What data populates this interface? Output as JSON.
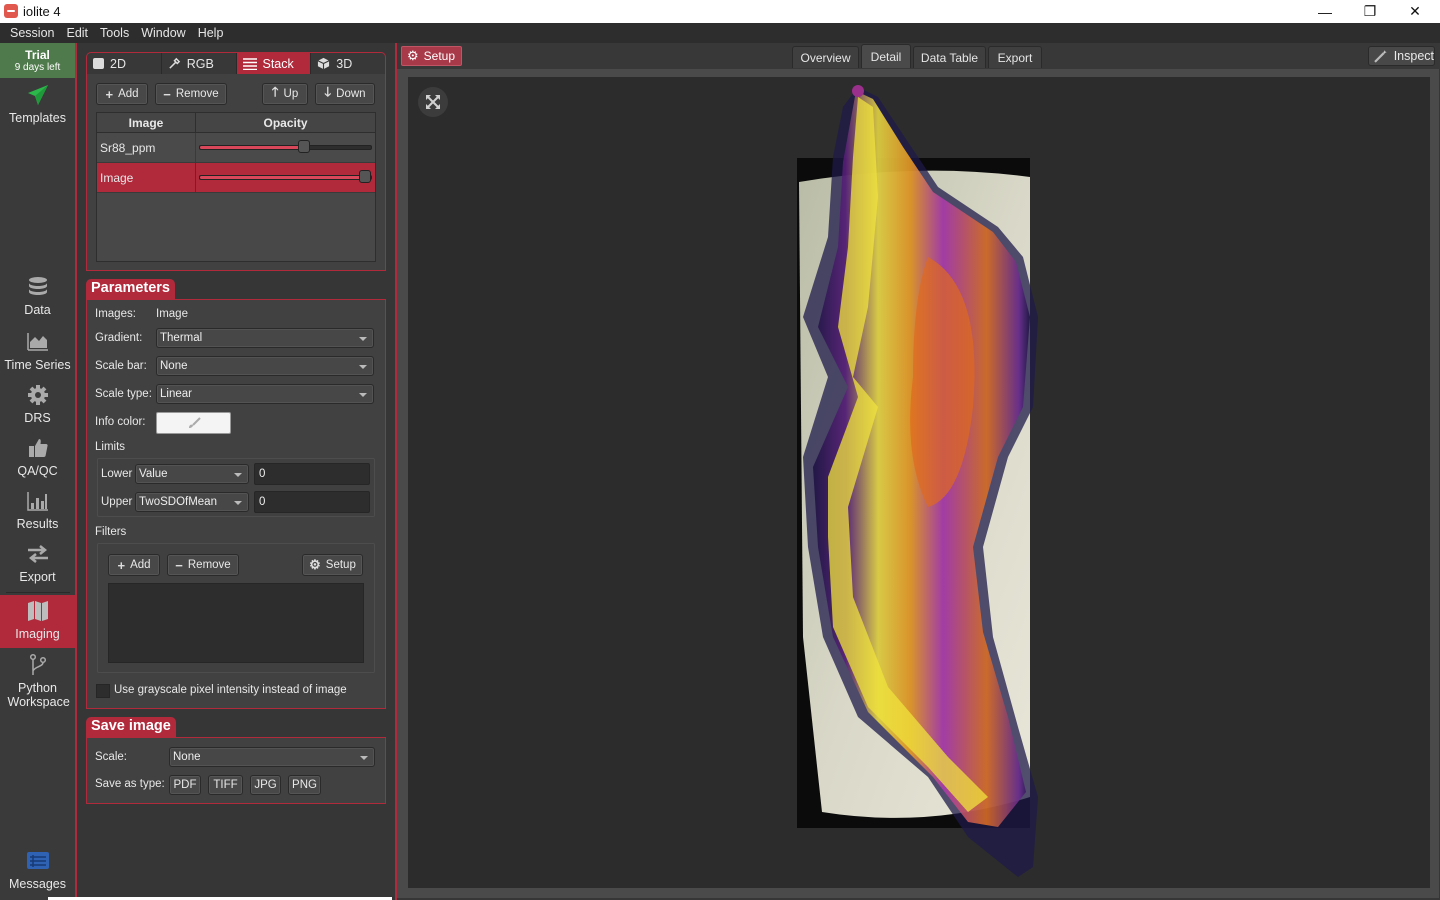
{
  "window": {
    "title": "iolite 4",
    "controls": {
      "minimize": "—",
      "maximize": "❐",
      "close": "✕"
    }
  },
  "menu": [
    "Session",
    "Edit",
    "Tools",
    "Window",
    "Help"
  ],
  "trial": {
    "title": "Trial",
    "subtitle": "9 days left"
  },
  "nav": {
    "templates": "Templates",
    "items": [
      {
        "label": "Data",
        "icon": "database-icon"
      },
      {
        "label": "Time Series",
        "icon": "area-chart-icon"
      },
      {
        "label": "DRS",
        "icon": "gear-icon"
      },
      {
        "label": "QA/QC",
        "icon": "thumbs-up-icon"
      },
      {
        "label": "Results",
        "icon": "bar-chart-icon"
      },
      {
        "label": "Export",
        "icon": "swap-arrows-icon"
      },
      {
        "label": "Imaging",
        "icon": "map-icon",
        "active": true
      },
      {
        "label": "Python Workspace",
        "icon": "git-branch-icon"
      }
    ],
    "messages": "Messages"
  },
  "viewTabs": [
    {
      "label": "2D",
      "icon": "square-icon"
    },
    {
      "label": "RGB",
      "icon": "eyedropper-icon"
    },
    {
      "label": "Stack",
      "icon": "stack-lines-icon",
      "active": true
    },
    {
      "label": "3D",
      "icon": "cube-icon"
    }
  ],
  "layerToolbar": {
    "add": "Add",
    "remove": "Remove",
    "up": "Up",
    "down": "Down"
  },
  "layerTable": {
    "columns": [
      "Image",
      "Opacity"
    ],
    "rows": [
      {
        "name": "Sr88_ppm",
        "opacity": 0.63,
        "selected": false
      },
      {
        "name": "Image",
        "opacity": 1.0,
        "selected": true
      }
    ]
  },
  "parameters": {
    "title": "Parameters",
    "images_label": "Images:",
    "images_value": "Image",
    "gradient_label": "Gradient:",
    "gradient_value": "Thermal",
    "scalebar_label": "Scale bar:",
    "scalebar_value": "None",
    "scaletype_label": "Scale type:",
    "scaletype_value": "Linear",
    "infocolor_label": "Info color:",
    "infocolor_value": "#f4f4f4",
    "limits_label": "Limits",
    "lower_label": "Lower",
    "lower_mode": "Value",
    "lower_value": "0",
    "upper_label": "Upper",
    "upper_mode": "TwoSDOfMean",
    "upper_value": "0",
    "filters_label": "Filters",
    "filters_add": "Add",
    "filters_remove": "Remove",
    "filters_setup": "Setup",
    "grayscale_label": "Use grayscale pixel intensity instead of image",
    "grayscale_checked": false
  },
  "saveImage": {
    "title": "Save image",
    "scale_label": "Scale:",
    "scale_value": "None",
    "saveas_label": "Save as type:",
    "types": [
      "PDF",
      "TIFF",
      "JPG",
      "PNG"
    ]
  },
  "main": {
    "setup": "Setup",
    "tabs": [
      {
        "label": "Overview"
      },
      {
        "label": "Detail",
        "active": true
      },
      {
        "label": "Data Table"
      },
      {
        "label": "Export"
      }
    ],
    "inspect": "Inspect",
    "accent": "#b02a3c"
  }
}
